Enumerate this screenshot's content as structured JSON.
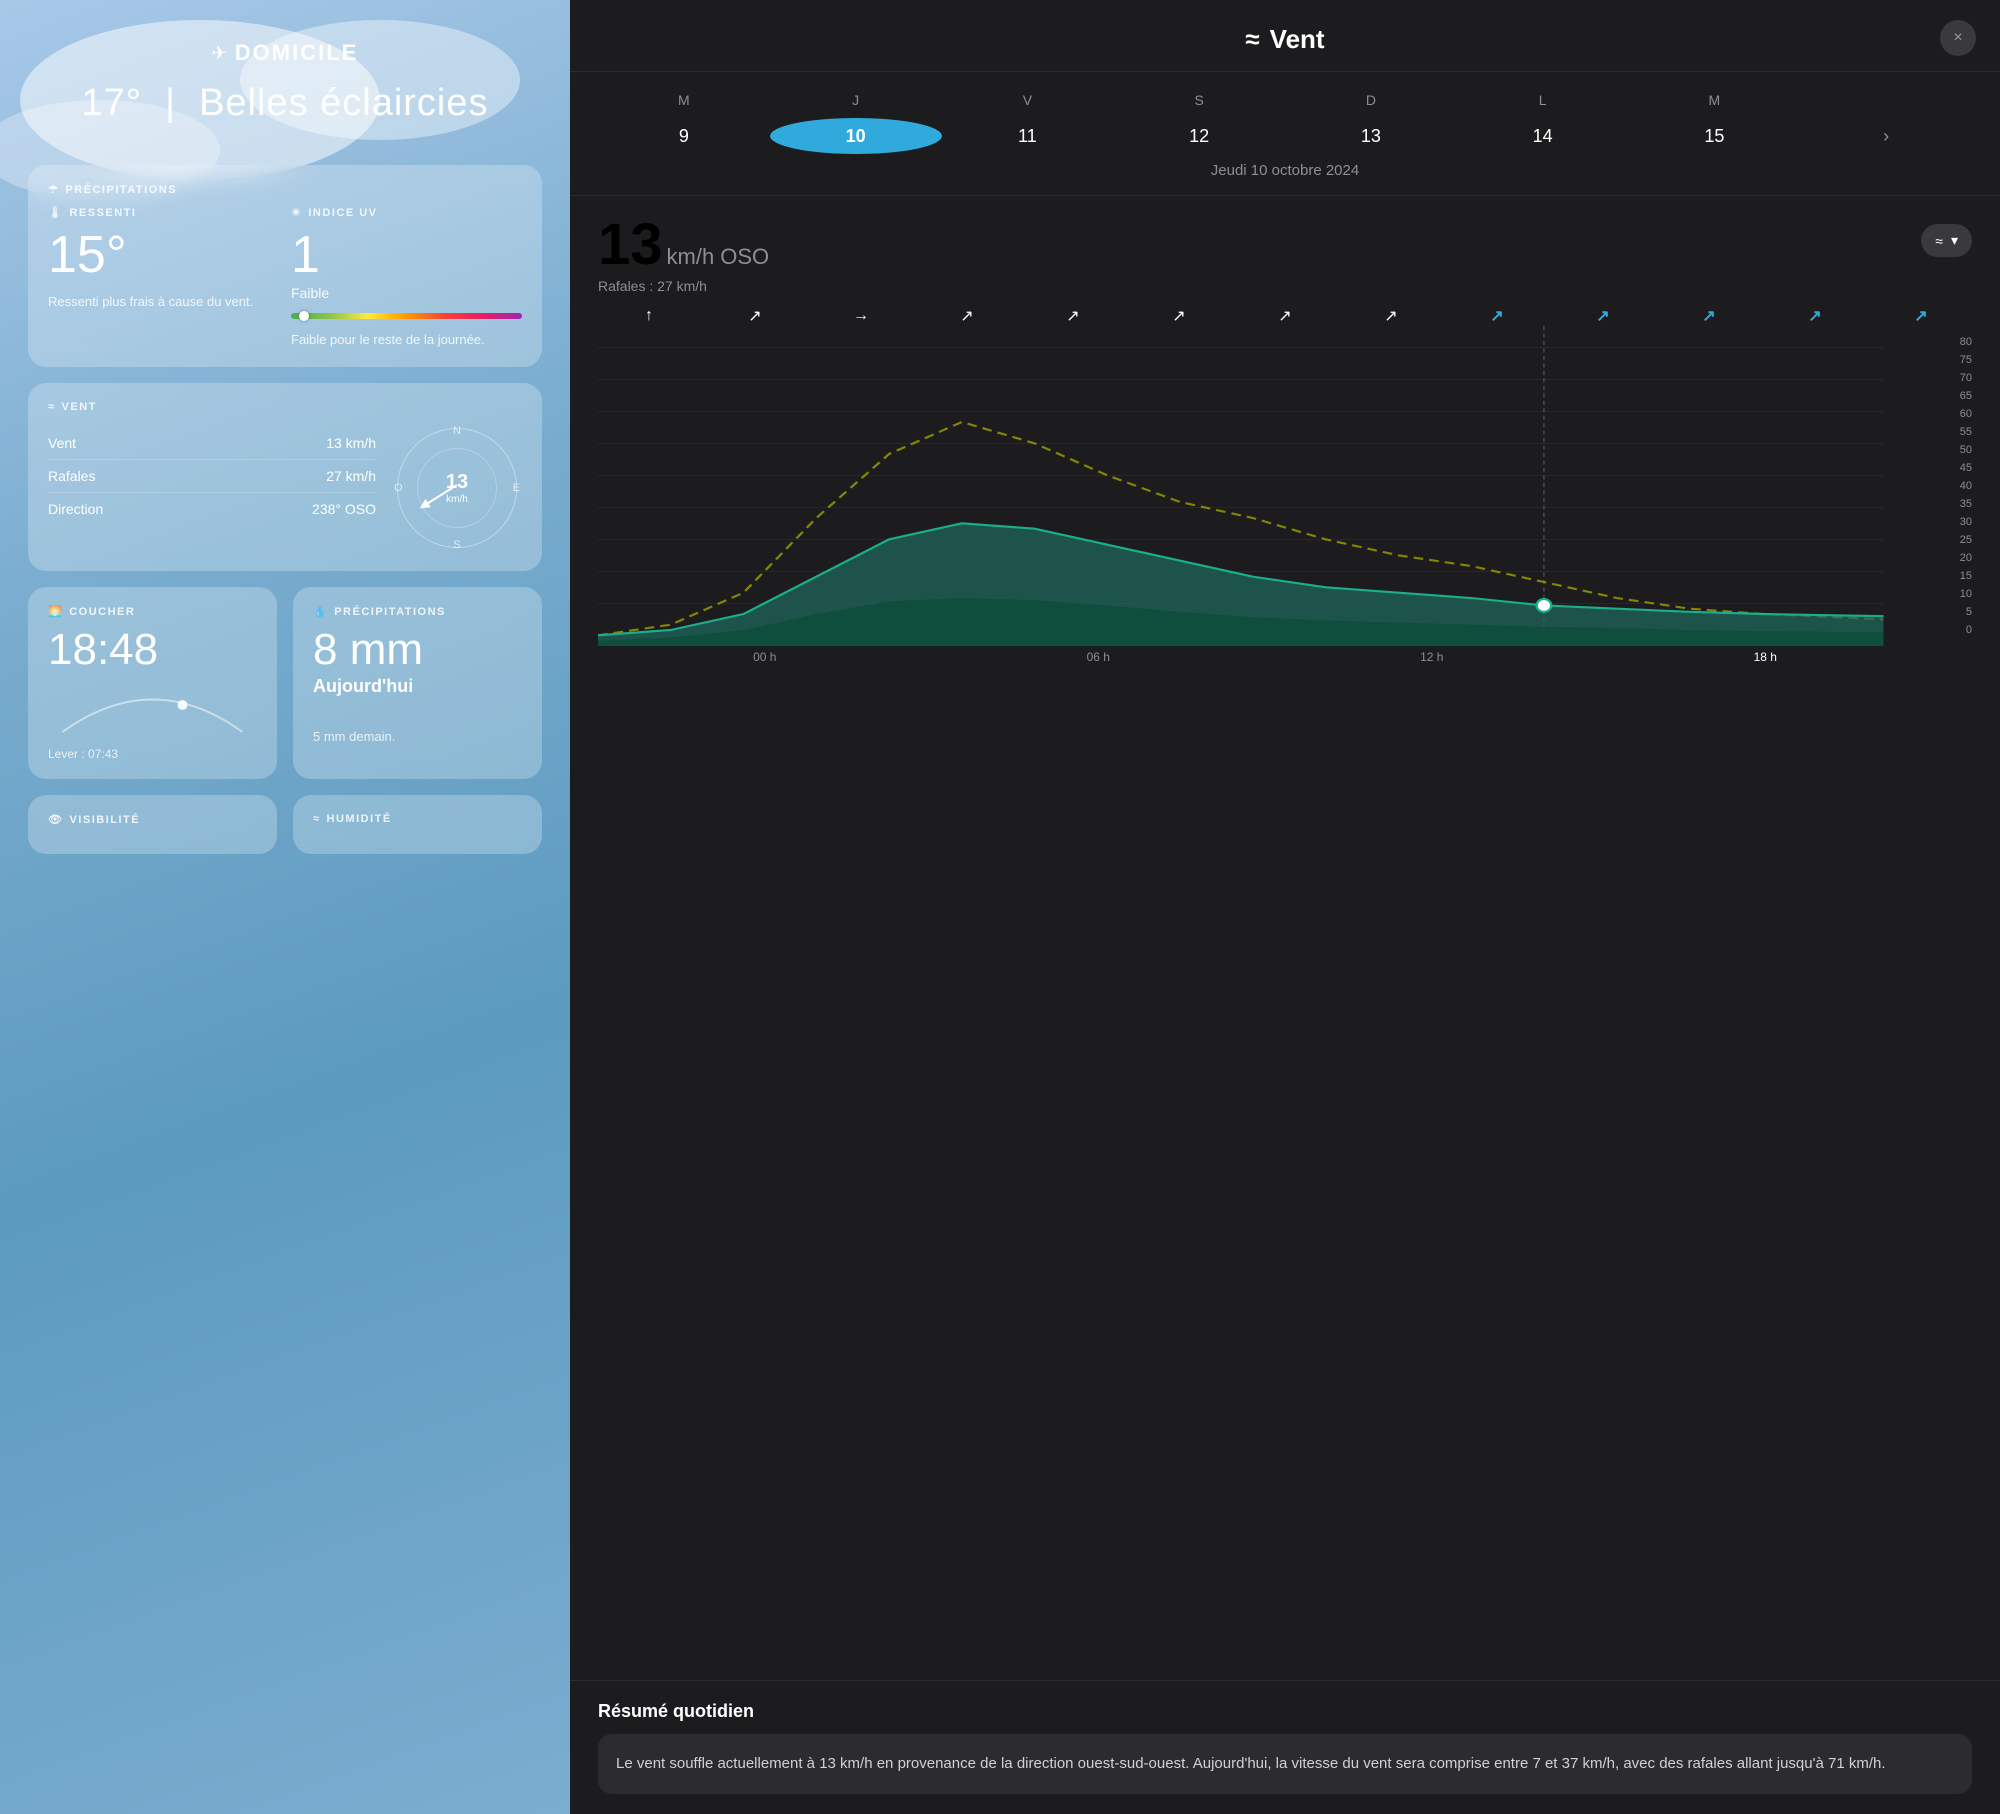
{
  "left": {
    "location": "DOMICILE",
    "temperature": "17°",
    "condition": "Belles éclaircies",
    "sections": {
      "precipitations_header": "PRÉCIPITATIONS",
      "ressenti": {
        "title": "RESSENTI",
        "value": "15°",
        "desc": "Ressenti plus frais à cause du vent."
      },
      "uv": {
        "title": "INDICE UV",
        "value": "1",
        "subtitle": "Faible",
        "desc": "Faible pour le reste de la journée."
      },
      "vent": {
        "title": "VENT",
        "rows": [
          {
            "label": "Vent",
            "value": "13 km/h"
          },
          {
            "label": "Rafales",
            "value": "27 km/h"
          },
          {
            "label": "Direction",
            "value": "238° OSO"
          }
        ],
        "compass": {
          "n": "N",
          "s": "S",
          "e": "E",
          "o": "O",
          "speed": "13",
          "unit": "km/h"
        }
      },
      "coucher": {
        "title": "COUCHER",
        "value": "18:48",
        "lever": "Lever : 07:43"
      },
      "precip": {
        "title": "PRÉCIPITATIONS",
        "value": "8 mm",
        "subtitle": "Aujourd'hui",
        "desc": "5 mm demain."
      },
      "visibilite": {
        "title": "VISIBILITÉ"
      },
      "humidite": {
        "title": "HUMIDITÉ"
      }
    }
  },
  "right": {
    "close_btn": "×",
    "title": "Vent",
    "wind_icon": "≈",
    "calendar": {
      "days": [
        "M",
        "J",
        "V",
        "S",
        "D",
        "L",
        "M"
      ],
      "dates": [
        "9",
        "10",
        "11",
        "12",
        "13",
        "14",
        "15"
      ],
      "active_index": 1,
      "selected_date": "Jeudi 10 octobre 2024",
      "more": "1"
    },
    "speed": {
      "number": "13",
      "unit": "km/h",
      "direction": "OSO",
      "gusts": "Rafales : 27 km/h"
    },
    "detail_btn_icon": "≈",
    "detail_btn_arrow": "▾",
    "arrows": [
      "↑",
      "↗",
      "→",
      "↗",
      "↗",
      "↗",
      "↗",
      "↗",
      "↗",
      "↗",
      "↗",
      "↗",
      "↗"
    ],
    "chart": {
      "y_labels": [
        "80",
        "75",
        "70",
        "65",
        "60",
        "55",
        "50",
        "45",
        "40",
        "35",
        "30",
        "25",
        "20",
        "15",
        "10",
        "5",
        "0"
      ],
      "x_labels": [
        "00 h",
        "06 h",
        "12 h",
        "18 h"
      ],
      "current_marker": "18h"
    },
    "summary": {
      "title": "Résumé quotidien",
      "text": "Le vent souffle actuellement à 13 km/h en provenance de la direction ouest-sud-ouest. Aujourd'hui, la vitesse du vent sera comprise entre 7 et 37 km/h, avec des rafales allant jusqu'à 71 km/h."
    }
  }
}
